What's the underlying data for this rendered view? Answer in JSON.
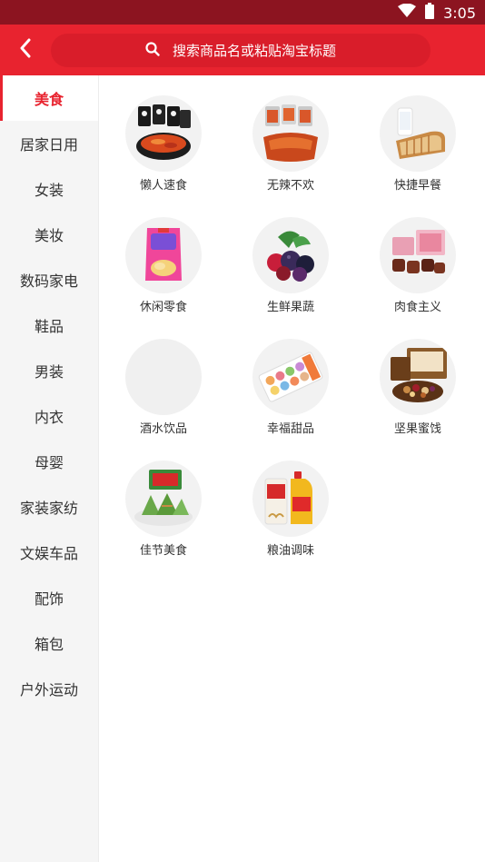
{
  "status_bar": {
    "time": "3:05",
    "icons": [
      "wifi-icon",
      "battery-icon"
    ]
  },
  "header": {
    "back_icon": "chevron-left-icon",
    "search_icon": "search-icon",
    "search_placeholder": "搜索商品名或粘贴淘宝标题"
  },
  "colors": {
    "brand_red": "#e8232f",
    "status_bar": "#8c1420",
    "search_bg": "#d91d2a",
    "sidebar_bg": "#f5f5f5"
  },
  "sidebar": {
    "active_index": 0,
    "items": [
      {
        "label": "美食"
      },
      {
        "label": "居家日用"
      },
      {
        "label": "女装"
      },
      {
        "label": "美妆"
      },
      {
        "label": "数码家电"
      },
      {
        "label": "鞋品"
      },
      {
        "label": "男装"
      },
      {
        "label": "内衣"
      },
      {
        "label": "母婴"
      },
      {
        "label": "家装家纺"
      },
      {
        "label": "文娱车品"
      },
      {
        "label": "配饰"
      },
      {
        "label": "箱包"
      },
      {
        "label": "户外运动"
      }
    ]
  },
  "categories": [
    {
      "label": "懒人速食",
      "icon": "instant-noodles-image"
    },
    {
      "label": "无辣不欢",
      "icon": "spicy-snacks-image"
    },
    {
      "label": "快捷早餐",
      "icon": "bread-milk-image"
    },
    {
      "label": "休闲零食",
      "icon": "chips-bag-image"
    },
    {
      "label": "生鲜果蔬",
      "icon": "berries-image"
    },
    {
      "label": "肉食主义",
      "icon": "meat-box-image"
    },
    {
      "label": "酒水饮品",
      "icon": "placeholder-image"
    },
    {
      "label": "幸福甜品",
      "icon": "macaron-box-image"
    },
    {
      "label": "坚果蜜饯",
      "icon": "nuts-gift-box-image"
    },
    {
      "label": "佳节美食",
      "icon": "zongzi-image"
    },
    {
      "label": "粮油调味",
      "icon": "rice-oil-image"
    }
  ]
}
